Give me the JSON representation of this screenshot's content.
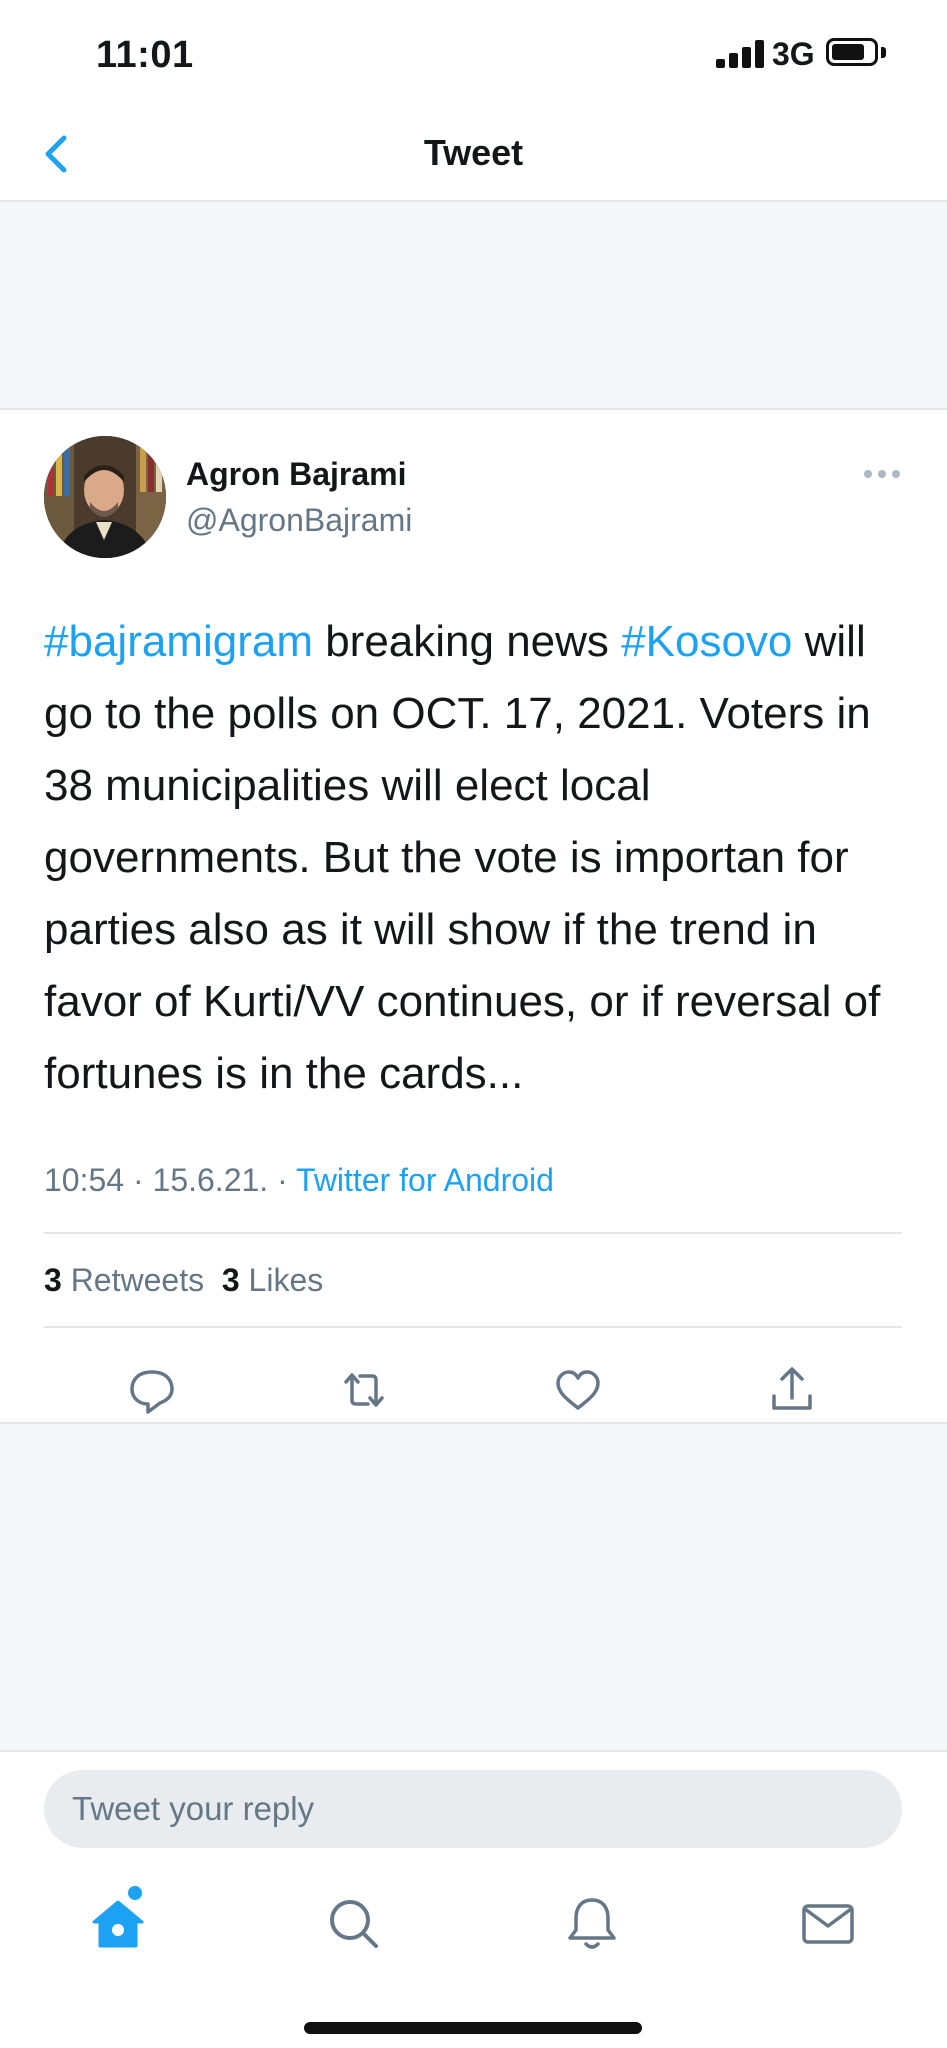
{
  "status_bar": {
    "time": "11:01",
    "network": "3G"
  },
  "nav": {
    "title": "Tweet",
    "back_icon": "chevron-left-icon"
  },
  "tweet": {
    "author_name": "Agron Bajrami",
    "author_handle": "@AgronBajrami",
    "text_segments": {
      "hashtag1": "#bajramigram",
      "text1": " breaking news ",
      "hashtag2": "#Kosovo",
      "text2": " will go to the polls on OCT. 17, 2021. Voters in 38 municipalities will elect local governments. But the vote is importan for parties also as it will show if the trend in favor of Kurti/VV continues, or if reversal of fortunes is in the cards..."
    },
    "time": "10:54",
    "date": "15.6.21.",
    "separator": "·",
    "source": "Twitter for Android",
    "retweets_count": "3",
    "retweets_label": "Retweets",
    "likes_count": "3",
    "likes_label": "Likes"
  },
  "actions": [
    "reply-icon",
    "retweet-icon",
    "like-icon",
    "share-icon"
  ],
  "reply": {
    "placeholder": "Tweet your reply"
  },
  "tabs": [
    "home-icon",
    "search-icon",
    "notifications-icon",
    "messages-icon"
  ],
  "colors": {
    "accent": "#1da1f2",
    "secondary_text": "#657786",
    "primary_text": "#14171a",
    "background": "#f5f8fa"
  }
}
